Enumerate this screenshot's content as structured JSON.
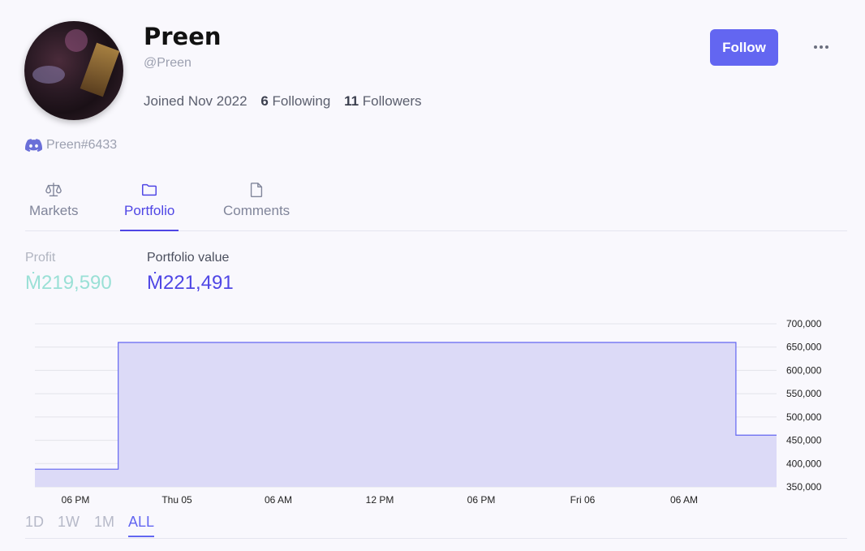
{
  "profile": {
    "display_name": "Preen",
    "username": "@Preen",
    "joined": "Joined Nov 2022",
    "following_count": "6",
    "following_label": "Following",
    "followers_count": "11",
    "followers_label": "Followers",
    "discord": "Preen#6433"
  },
  "actions": {
    "follow_label": "Follow",
    "more_icon": "more-horizontal-icon"
  },
  "tabs": [
    {
      "label": "Markets",
      "icon": "scale-icon",
      "active": false
    },
    {
      "label": "Portfolio",
      "icon": "folder-icon",
      "active": true
    },
    {
      "label": "Comments",
      "icon": "document-icon",
      "active": false
    }
  ],
  "summary": {
    "profit_label": "Profit",
    "profit_value": "Ṁ219,590",
    "portfolio_label": "Portfolio value",
    "portfolio_value": "Ṁ221,491"
  },
  "colors": {
    "accent": "#6366f1",
    "profit": "#9ae0d6",
    "area_fill": "#dcdaf7",
    "area_line": "#6366f1"
  },
  "chart_data": {
    "type": "area",
    "x_ticks": [
      "06 PM",
      "Thu 05",
      "06 AM",
      "12 PM",
      "06 PM",
      "Fri 06",
      "06 AM"
    ],
    "y_ticks": [
      "700,000",
      "650,000",
      "600,000",
      "550,000",
      "500,000",
      "450,000",
      "400,000",
      "350,000"
    ],
    "ylim": [
      350000,
      700000
    ],
    "series": [
      {
        "x_hours": [
          0,
          8.2,
          8.2,
          69,
          69,
          73
        ],
        "values": [
          388000,
          388000,
          660000,
          660000,
          461000,
          461000
        ]
      }
    ],
    "grid": true
  },
  "period_tabs": [
    {
      "label": "1D",
      "active": false
    },
    {
      "label": "1W",
      "active": false
    },
    {
      "label": "1M",
      "active": false
    },
    {
      "label": "ALL",
      "active": true
    }
  ]
}
